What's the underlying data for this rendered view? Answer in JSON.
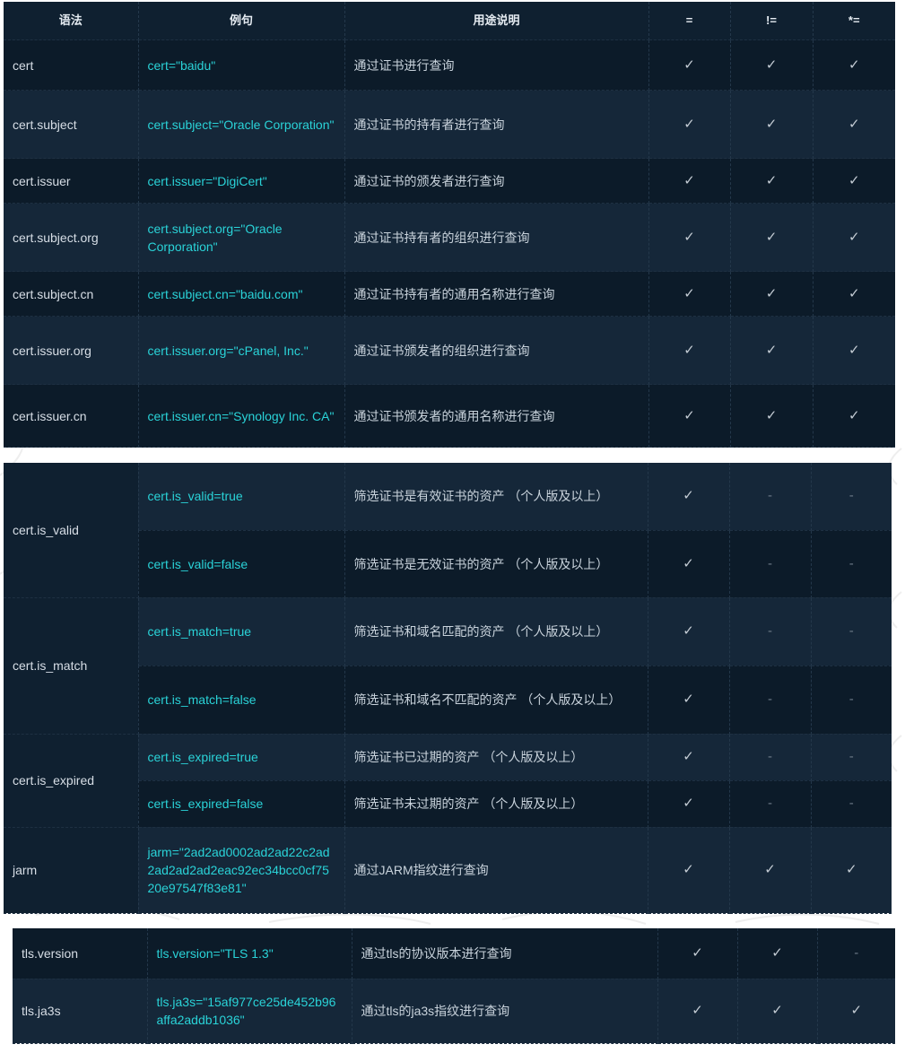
{
  "table1": {
    "headers": {
      "syntax": "语法",
      "example": "例句",
      "description": "用途说明",
      "eq": "=",
      "neq": "!=",
      "contains": "*="
    },
    "rows": [
      {
        "syntax": "cert",
        "example": "cert=\"baidu\"",
        "description": "通过证书进行查询",
        "eq": "✓",
        "neq": "✓",
        "contains": "✓"
      },
      {
        "syntax": "cert.subject",
        "example": "cert.subject=\"Oracle Corporation\"",
        "description": "通过证书的持有者进行查询",
        "eq": "✓",
        "neq": "✓",
        "contains": "✓"
      },
      {
        "syntax": "cert.issuer",
        "example": "cert.issuer=\"DigiCert\"",
        "description": "通过证书的颁发者进行查询",
        "eq": "✓",
        "neq": "✓",
        "contains": "✓"
      },
      {
        "syntax": "cert.subject.org",
        "example": "cert.subject.org=\"Oracle Corporation\"",
        "description": "通过证书持有者的组织进行查询",
        "eq": "✓",
        "neq": "✓",
        "contains": "✓"
      },
      {
        "syntax": "cert.subject.cn",
        "example": "cert.subject.cn=\"baidu.com\"",
        "description": "通过证书持有者的通用名称进行查询",
        "eq": "✓",
        "neq": "✓",
        "contains": "✓"
      },
      {
        "syntax": "cert.issuer.org",
        "example": "cert.issuer.org=\"cPanel, Inc.\"",
        "description": "通过证书颁发者的组织进行查询",
        "eq": "✓",
        "neq": "✓",
        "contains": "✓"
      },
      {
        "syntax": "cert.issuer.cn",
        "example": "cert.issuer.cn=\"Synology Inc. CA\"",
        "description": "通过证书颁发者的通用名称进行查询",
        "eq": "✓",
        "neq": "✓",
        "contains": "✓"
      }
    ]
  },
  "table2": {
    "groups": [
      {
        "syntax": "cert.is_valid",
        "rows": [
          {
            "example": "cert.is_valid=true",
            "description": "筛选证书是有效证书的资产 （个人版及以上）",
            "eq": "✓",
            "neq": "-",
            "contains": "-"
          },
          {
            "example": "cert.is_valid=false",
            "description": "筛选证书是无效证书的资产 （个人版及以上）",
            "eq": "✓",
            "neq": "-",
            "contains": "-"
          }
        ]
      },
      {
        "syntax": "cert.is_match",
        "rows": [
          {
            "example": "cert.is_match=true",
            "description": "筛选证书和域名匹配的资产 （个人版及以上）",
            "eq": "✓",
            "neq": "-",
            "contains": "-"
          },
          {
            "example": "cert.is_match=false",
            "description": "筛选证书和域名不匹配的资产 （个人版及以上）",
            "eq": "✓",
            "neq": "-",
            "contains": "-"
          }
        ]
      },
      {
        "syntax": "cert.is_expired",
        "rows": [
          {
            "example": "cert.is_expired=true",
            "description": "筛选证书已过期的资产 （个人版及以上）",
            "eq": "✓",
            "neq": "-",
            "contains": "-"
          },
          {
            "example": "cert.is_expired=false",
            "description": "筛选证书未过期的资产 （个人版及以上）",
            "eq": "✓",
            "neq": "-",
            "contains": "-"
          }
        ]
      },
      {
        "syntax": "jarm",
        "rows": [
          {
            "example": "jarm=\"2ad2ad0002ad2ad22c2ad2ad2ad2ad2eac92ec34bcc0cf7520e97547f83e81\"",
            "description": "通过JARM指纹进行查询",
            "eq": "✓",
            "neq": "✓",
            "contains": "✓"
          }
        ]
      }
    ]
  },
  "table3": {
    "rows": [
      {
        "syntax": "tls.version",
        "example": "tls.version=\"TLS 1.3\"",
        "description": "通过tls的协议版本进行查询",
        "eq": "✓",
        "neq": "✓",
        "contains": "-"
      },
      {
        "syntax": "tls.ja3s",
        "example": "tls.ja3s=\"15af977ce25de452b96affa2addb1036\"",
        "description": "通过tls的ja3s指纹进行查询",
        "eq": "✓",
        "neq": "✓",
        "contains": "✓"
      }
    ]
  },
  "colors": {
    "background": "#0c1b29",
    "alt_row": "#152739",
    "example_text": "#2ad3d8",
    "dash": "#6c7a87"
  }
}
